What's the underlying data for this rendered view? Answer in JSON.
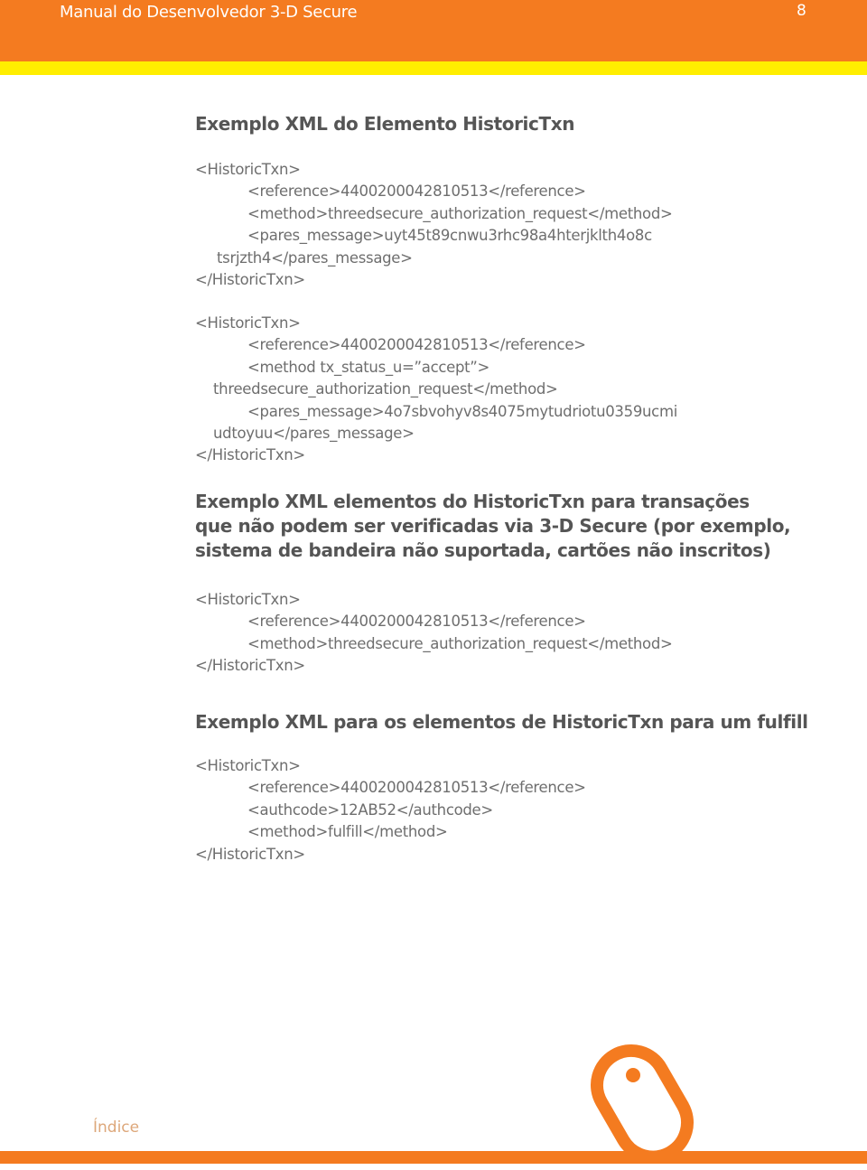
{
  "header": {
    "title": "Manual do Desenvolvedor 3-D Secure",
    "page_number": "8"
  },
  "colors": {
    "brand_orange": "#F47B20",
    "accent_yellow": "#FFEE00",
    "footer_link": "#DDA77A"
  },
  "sections": [
    {
      "title": "Exemplo XML do Elemento HistoricTxn",
      "code": [
        "<HistoricTxn>",
        "<reference>4400200042810513</reference>",
        "<method>threedsecure_authorization_request</method>",
        "<pares_message>uyt45t89cnwu3rhc98a4hterjklth4o8c",
        "tsrjzth4</pares_message>",
        "</HistoricTxn>"
      ]
    },
    {
      "title": "",
      "code": [
        "<HistoricTxn>",
        "<reference>4400200042810513</reference>",
        "<method tx_status_u=”accept”>",
        "threedsecure_authorization_request</method>",
        "<pares_message>4o7sbvohyv8s4075mytudriotu0359ucmi",
        "udtoyuu</pares_message>",
        "</HistoricTxn>"
      ]
    },
    {
      "title_lines": [
        "Exemplo XML elementos do HistoricTxn para transações",
        "que não podem ser verificadas via 3-D Secure (por exemplo,",
        "sistema de bandeira não suportada, cartões não inscritos)"
      ],
      "code": [
        "<HistoricTxn>",
        "<reference>4400200042810513</reference>",
        "<method>threedsecure_authorization_request</method>",
        "</HistoricTxn>"
      ]
    },
    {
      "title": "Exemplo XML para os elementos de HistoricTxn para um fulfill",
      "code": [
        "<HistoricTxn>",
        "<reference>4400200042810513</reference>",
        "<authcode>12AB52</authcode>",
        "<method>fulfill</method>",
        "</HistoricTxn>"
      ]
    }
  ],
  "footer": {
    "index_link": "Índice",
    "icon": "mouse-icon"
  }
}
